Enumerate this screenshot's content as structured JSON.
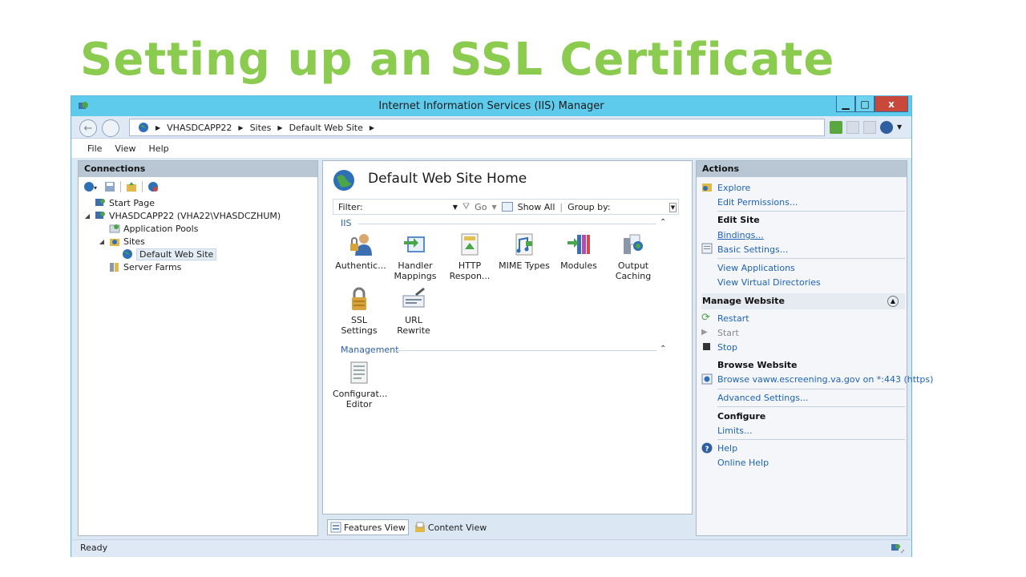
{
  "slide": {
    "title": "Setting up an SSL Certificate"
  },
  "window": {
    "title": "Internet Information Services (IIS) Manager",
    "controls": {
      "minimize": "▁",
      "maximize": "□",
      "close": "x"
    }
  },
  "address": {
    "crumbs": [
      "VHASDCAPP22",
      "Sites",
      "Default Web Site"
    ]
  },
  "menu": [
    "File",
    "View",
    "Help"
  ],
  "connections": {
    "header": "Connections",
    "tree": [
      {
        "label": "Start Page"
      },
      {
        "label": "VHASDCAPP22 (VHA22\\VHASDCZHUM)"
      },
      {
        "label": "Application Pools"
      },
      {
        "label": "Sites"
      },
      {
        "label": "Default Web Site"
      },
      {
        "label": "Server Farms"
      }
    ]
  },
  "center": {
    "title": "Default Web Site Home",
    "filter": {
      "label": "Filter:",
      "go": "Go",
      "show_all": "Show All",
      "group_by": "Group by:"
    },
    "groups": [
      {
        "name": "IIS",
        "features": [
          {
            "label1": "Authentic...",
            "label2": "",
            "icon": "authentication-icon"
          },
          {
            "label1": "Handler",
            "label2": "Mappings",
            "icon": "handler-mappings-icon"
          },
          {
            "label1": "HTTP",
            "label2": "Respon...",
            "icon": "http-response-icon"
          },
          {
            "label1": "MIME Types",
            "label2": "",
            "icon": "mime-types-icon"
          },
          {
            "label1": "Modules",
            "label2": "",
            "icon": "modules-icon"
          },
          {
            "label1": "Output",
            "label2": "Caching",
            "icon": "output-caching-icon"
          },
          {
            "label1": "SSL Settings",
            "label2": "",
            "icon": "ssl-lock-icon"
          },
          {
            "label1": "URL Rewrite",
            "label2": "",
            "icon": "url-rewrite-icon"
          }
        ]
      },
      {
        "name": "Management",
        "features": [
          {
            "label1": "Configurat...",
            "label2": "Editor",
            "icon": "configuration-editor-icon"
          }
        ]
      }
    ],
    "tabs": {
      "features_view": "Features View",
      "content_view": "Content View"
    }
  },
  "actions": {
    "header": "Actions",
    "explore": "Explore",
    "edit_permissions": "Edit Permissions...",
    "edit_site": "Edit Site",
    "bindings": "Bindings...",
    "basic_settings": "Basic Settings...",
    "view_applications": "View Applications",
    "view_virtual_dirs": "View Virtual Directories",
    "manage_website": "Manage Website",
    "restart": "Restart",
    "start": "Start",
    "stop": "Stop",
    "browse_website": "Browse Website",
    "browse_link": "Browse vaww.escreening.va.gov on *:443 (https)",
    "advanced_settings": "Advanced Settings...",
    "configure": "Configure",
    "limits": "Limits...",
    "help": "Help",
    "online_help": "Online Help"
  },
  "status": {
    "text": "Ready"
  },
  "colors": {
    "title_green": "#8bcb4f",
    "titlebar": "#5ecbec",
    "link": "#1e63b8",
    "close": "#c9483c"
  }
}
